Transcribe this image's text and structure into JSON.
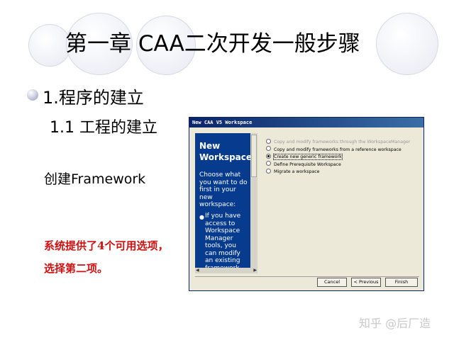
{
  "slide": {
    "title": "第一章  CAA二次开发一般步骤",
    "bullet": "1.程序的建立",
    "subheading": "1.1 工程的建立",
    "create_label": "创建Framework",
    "note_line1": "系统提供了4个可用选项，",
    "note_line2": "选择第二项。",
    "watermark": "知乎 @后厂造"
  },
  "dialog": {
    "title": "New CAA V5 Workspace",
    "left_panel": {
      "title": "New Workspace",
      "description": "Choose what you want to do first in your new workspace:",
      "bullet": "If you have access to Workspace Manager tools, you can modify an existing framework"
    },
    "options": [
      {
        "label": "Copy and modify frameworks through the WorkspaceManager",
        "enabled": false,
        "checked": false
      },
      {
        "label": "Copy and modify frameworks from a reference workspace",
        "enabled": true,
        "checked": false
      },
      {
        "label": "Create new generic framework",
        "enabled": true,
        "checked": true
      },
      {
        "label": "Define Prerequisite Workspace",
        "enabled": true,
        "checked": false
      },
      {
        "label": "Migrate a workspace",
        "enabled": true,
        "checked": false
      }
    ],
    "buttons": {
      "cancel": "Cancel",
      "previous": "< Previous",
      "finish": "Finish"
    }
  },
  "colors": {
    "title_bar": "#0a246a",
    "left_panel": "#063b8e",
    "note_text": "#d01010",
    "dialog_bg": "#ece9d8"
  }
}
